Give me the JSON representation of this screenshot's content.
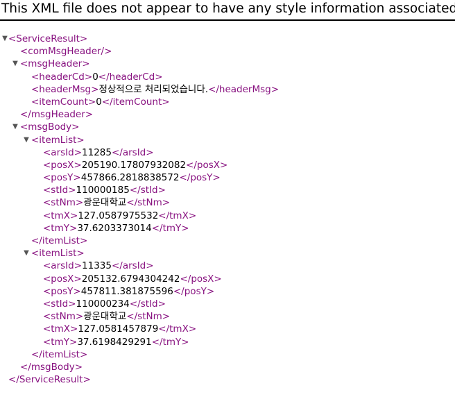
{
  "banner": {
    "text": "This XML file does not appear to have any style information associated"
  },
  "icons": {
    "expanded": "triangle-down-icon"
  },
  "colors": {
    "tag": "#881280",
    "text": "#000000",
    "toggle": "#555555"
  },
  "xml": {
    "root_open": "<ServiceResult>",
    "com_msg_header": "<comMsgHeader/>",
    "msg_header_open": "<msgHeader>",
    "header_cd": {
      "open": "<headerCd>",
      "value": "0",
      "close": "</headerCd>"
    },
    "header_msg": {
      "open": "<headerMsg>",
      "value": "정상적으로 처리되었습니다.",
      "close": "</headerMsg>"
    },
    "item_count": {
      "open": "<itemCount>",
      "value": "0",
      "close": "</itemCount>"
    },
    "msg_header_close": "</msgHeader>",
    "msg_body_open": "<msgBody>",
    "item_list_open": "<itemList>",
    "item_list_close": "</itemList>",
    "items": [
      {
        "fields": [
          {
            "open": "<arsId>",
            "value": "11285",
            "close": "</arsId>"
          },
          {
            "open": "<posX>",
            "value": "205190.17807932082",
            "close": "</posX>"
          },
          {
            "open": "<posY>",
            "value": "457866.2818838572",
            "close": "</posY>"
          },
          {
            "open": "<stId>",
            "value": "110000185",
            "close": "</stId>"
          },
          {
            "open": "<stNm>",
            "value": "광운대학교",
            "close": "</stNm>"
          },
          {
            "open": "<tmX>",
            "value": "127.0587975532",
            "close": "</tmX>"
          },
          {
            "open": "<tmY>",
            "value": "37.6203373014",
            "close": "</tmY>"
          }
        ]
      },
      {
        "fields": [
          {
            "open": "<arsId>",
            "value": "11335",
            "close": "</arsId>"
          },
          {
            "open": "<posX>",
            "value": "205132.6794304242",
            "close": "</posX>"
          },
          {
            "open": "<posY>",
            "value": "457811.381875596",
            "close": "</posY>"
          },
          {
            "open": "<stId>",
            "value": "110000234",
            "close": "</stId>"
          },
          {
            "open": "<stNm>",
            "value": "광운대학교",
            "close": "</stNm>"
          },
          {
            "open": "<tmX>",
            "value": "127.0581457879",
            "close": "</tmX>"
          },
          {
            "open": "<tmY>",
            "value": "37.6198429291",
            "close": "</tmY>"
          }
        ]
      }
    ],
    "msg_body_close": "</msgBody>",
    "root_close": "</ServiceResult>"
  }
}
